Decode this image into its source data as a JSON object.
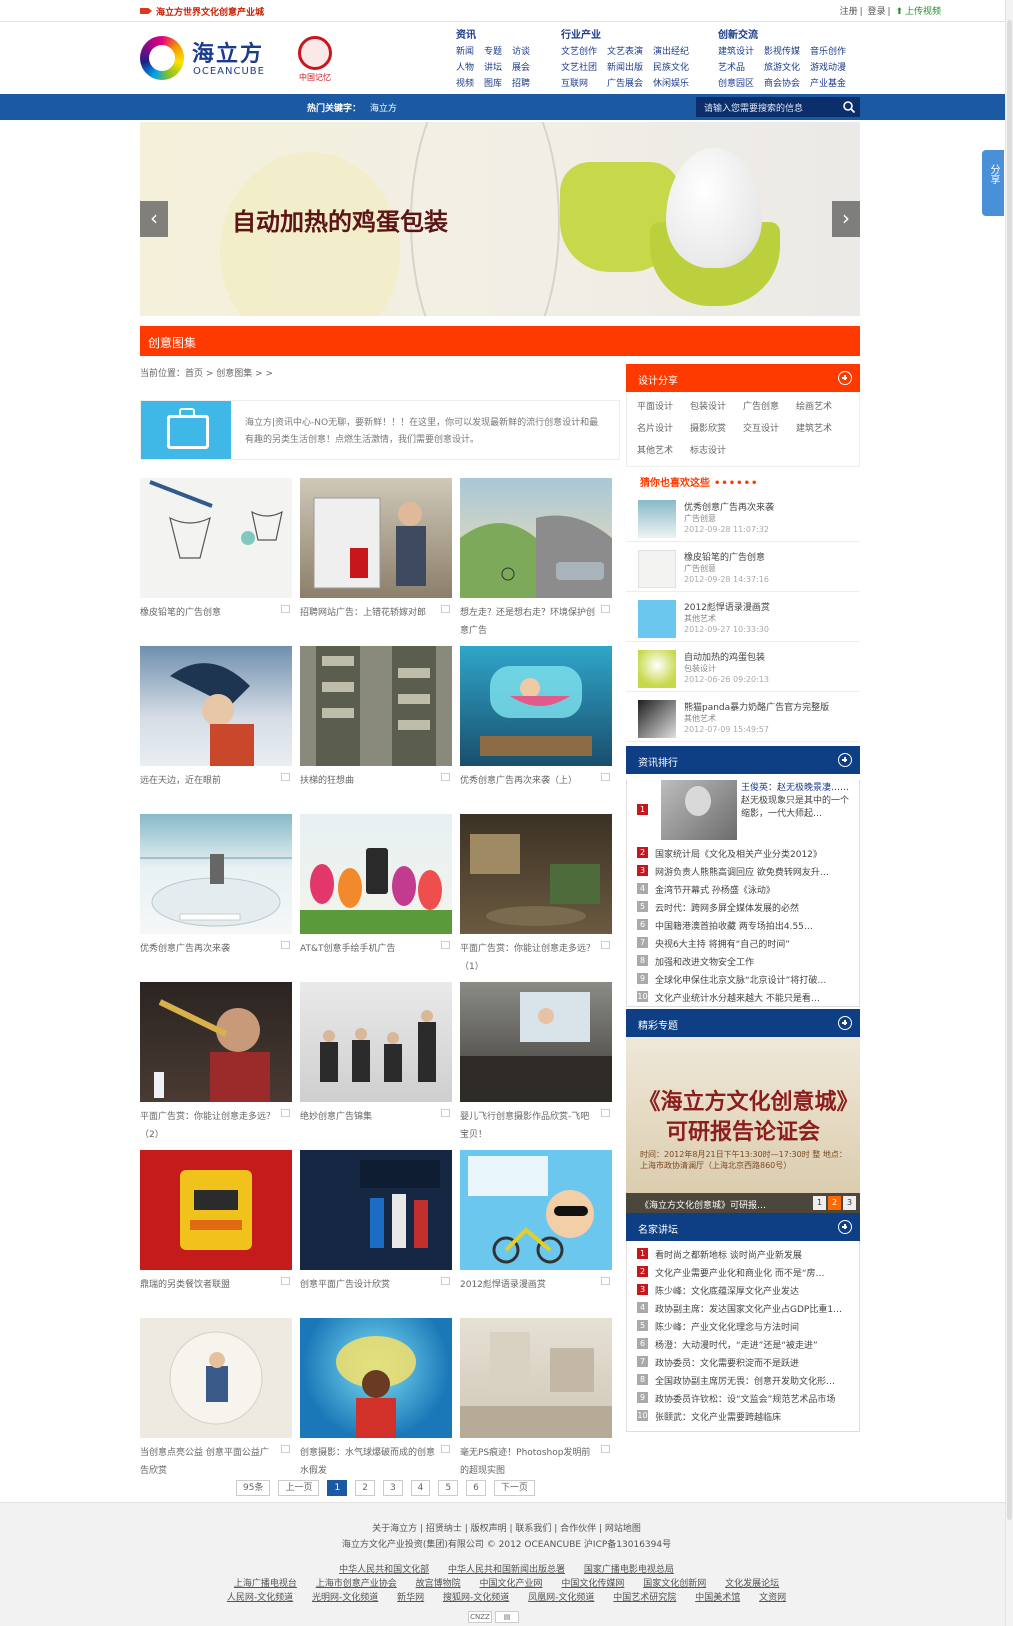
{
  "topbar": {
    "slogan": "海立方世界文化创意产业城",
    "register": "注册",
    "login": "登录",
    "upload": "上传视频"
  },
  "logo": {
    "cn": "海立方",
    "en": "OCEANCUBE",
    "partner": "中国记忆"
  },
  "nav": [
    {
      "title": "资讯",
      "items": [
        "新闻",
        "专题",
        "访谈",
        "人物",
        "讲坛",
        "展会",
        "视频",
        "图库",
        "招聘"
      ]
    },
    {
      "title": "行业产业",
      "items": [
        "文艺创作",
        "文艺表演",
        "演出经纪",
        "文艺社团",
        "新闻出版",
        "民族文化",
        "互联网",
        "广告展会",
        "休闲娱乐"
      ]
    },
    {
      "title": "创新交流",
      "items": [
        "建筑设计",
        "影视传媒",
        "音乐创作",
        "艺术品",
        "旅游文化",
        "游戏动漫",
        "创意园区",
        "商会协会",
        "产业基金"
      ]
    }
  ],
  "hot": {
    "label": "热门关键字：",
    "keyword": "海立方"
  },
  "search": {
    "placeholder": "请输入您需要搜索的信息"
  },
  "banner": {
    "caption": "自动加热的鸡蛋包装"
  },
  "share_label": "分享",
  "section_title": "创意图集",
  "breadcrumb": "当前位置：首页 > 创意图集 > >",
  "intro_text": "海立方|资讯中心-NO无聊，要新鲜！！！在这里，你可以发现最新鲜的流行创意设计和最有趣的另类生活创意！点燃生活激情，我们需要创意设计。",
  "cards": [
    {
      "title": "橡皮铅笔的广告创意"
    },
    {
      "title": "招聘网站广告：上错花轿嫁对郎"
    },
    {
      "title": "想左走？还是想右走？环境保护创意广告"
    },
    {
      "title": "远在天边，近在眼前"
    },
    {
      "title": "扶梯的狂想曲"
    },
    {
      "title": "优秀创意广告再次来袭（上）"
    },
    {
      "title": "优秀创意广告再次来袭"
    },
    {
      "title": "AT&T创意手绘手机广告"
    },
    {
      "title": "平面广告赏：你能让创意走多远？（1）"
    },
    {
      "title": "平面广告赏：你能让创意走多远？（2）"
    },
    {
      "title": "绝妙创意广告锦集"
    },
    {
      "title": "婴儿飞行创意摄影作品欣赏-飞吧宝贝！"
    },
    {
      "title": "鼎瑞的另类餐饮者联盟"
    },
    {
      "title": "创意平面广告设计欣赏"
    },
    {
      "title": "2012彪悍语录漫画赏"
    },
    {
      "title": "当创意点亮公益 创意平面公益广告欣赏"
    },
    {
      "title": "创意摄影：水气球爆破而成的创意水假发"
    },
    {
      "title": "毫无PS痕迹！Photoshop发明前的超现实图"
    }
  ],
  "pager": {
    "total": "95条",
    "prev": "上一页",
    "pages": [
      "1",
      "2",
      "3",
      "4",
      "5",
      "6"
    ],
    "next": "下一页"
  },
  "design_share": {
    "title": "设计分享",
    "tags": [
      "平面设计",
      "包装设计",
      "广告创意",
      "绘画艺术",
      "名片设计",
      "摄影欣赏",
      "交互设计",
      "建筑艺术",
      "其他艺术",
      "标志设计"
    ]
  },
  "guess": {
    "title": "猜你也喜欢这些",
    "dots": "••••••"
  },
  "guess_items": [
    {
      "title": "优秀创意广告再次来袭",
      "cat": "广告创意",
      "date": "2012-09-28 11:07:32"
    },
    {
      "title": "橡皮铅笔的广告创意",
      "cat": "广告创意",
      "date": "2012-09-28 14:37:16"
    },
    {
      "title": "2012彪悍语录漫画赏",
      "cat": "其他艺术",
      "date": "2012-09-27 10:33:30"
    },
    {
      "title": "自动加热的鸡蛋包装",
      "cat": "包装设计",
      "date": "2012-06-26 09:20:13"
    },
    {
      "title": "熊猫panda暴力奶酪广告官方完整版",
      "cat": "其他艺术",
      "date": "2012-07-09 15:49:57"
    }
  ],
  "ranking": {
    "title": "资讯排行",
    "first_title": "王俊英：赵无极晚景凄……",
    "first_desc": "赵无极现象只是其中的一个缩影，一代大师起…",
    "items": [
      "国家统计局《文化及相关产业分类2012》",
      "网游负责人熊熊高调回应 欲免费转网友升…",
      "金湾节开幕式 孙杨盛《泳动》",
      "云时代：跨网多屏全媒体发展的必然",
      "中国籍港澳首拍收藏 两专场拍出4.55…",
      "央视6大主持 将拥有“自己的时间”",
      "加强和改进文物安全工作",
      "全球化申保住北京文脉“北京设计”将打破…",
      "文化产业统计水分越来越大 不能只是看…"
    ]
  },
  "topic": {
    "title": "精彩专题",
    "board": "《海立方文化创意城》可研报告论证会",
    "small": "时间：2012年8月21日下午13:30时—17:30时 整 地点：上海市政协清澜厅（上海北京西路860号）",
    "caption": "《海立方文化创意城》可研报…",
    "dots": [
      "1",
      "2",
      "3"
    ]
  },
  "lecture": {
    "title": "名家讲坛",
    "items": [
      "看时尚之都新地标 谈时尚产业新发展",
      "文化产业需要产业化和商业化 而不是“房…",
      "陈少峰：文化底蕴深厚文化产业发达",
      "政协副主席：发达国家文化产业占GDP比重1…",
      "陈少峰：产业文化化理念与方法时间",
      "杨澄：大动漫时代，“走进”还是“被走进”",
      "政协委员：文化需要积淀而不是跃进",
      "全国政协副主席厉无畏：创意开发助文化形…",
      "政协委员许钦松：设“文监会”规范艺术品市场",
      "张颐武：文化产业需要跨越临床"
    ]
  },
  "footer": {
    "line1": "关于海立方 | 招贤纳士 | 版权声明 | 联系我们 | 合作伙伴 | 网站地图",
    "line2": "海立方文化产业投资(集团)有限公司 © 2012 OCEANCUBE 沪ICP备13016394号",
    "links_row1": [
      "中华人民共和国文化部",
      "中华人民共和国新闻出版总署",
      "国家广播电影电视总局"
    ],
    "links_row2": [
      "上海广播电视台",
      "上海市创意产业协会",
      "故宫博物院",
      "中国文化产业网",
      "中国文化传媒网",
      "国家文化创新网",
      "文化发展论坛"
    ],
    "links_row3": [
      "人民网-文化频道",
      "光明网-文化频道",
      "新华网",
      "搜狐网-文化频道",
      "凤凰网-文化频道",
      "中国艺术研究院",
      "中国美术馆",
      "文资网"
    ],
    "badges": [
      "CNZZ",
      "▤"
    ]
  }
}
